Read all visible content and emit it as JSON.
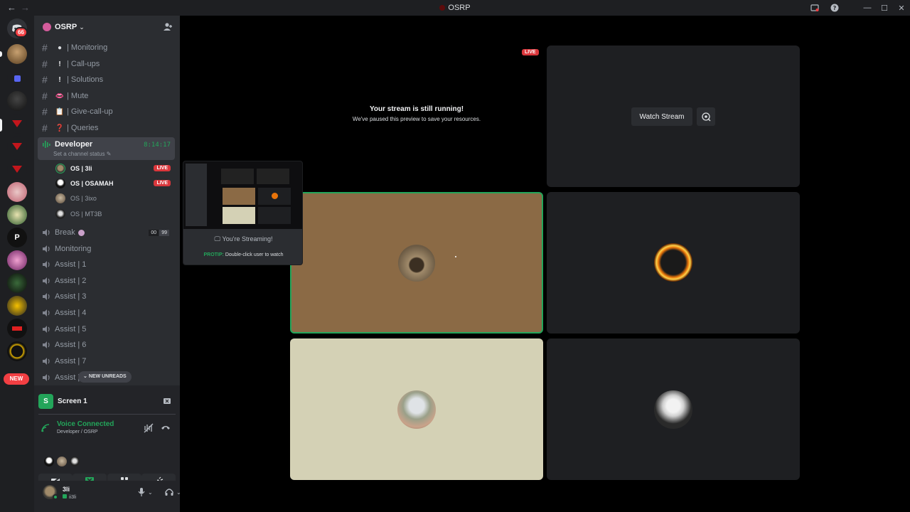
{
  "window": {
    "title": "OSRP"
  },
  "server": {
    "name": "OSRP"
  },
  "badges": {
    "dm_unread": "66",
    "new": "NEW"
  },
  "text_channels": [
    {
      "emoji": "●",
      "name": "| Monitoring"
    },
    {
      "emoji": "!",
      "name": "| Call-ups"
    },
    {
      "emoji": "!",
      "name": "| Solutions"
    },
    {
      "emoji": "👄",
      "name": "| Mute"
    },
    {
      "emoji": "📋",
      "name": "| Give-call-up"
    },
    {
      "emoji": "❓",
      "name": "| Queries"
    }
  ],
  "active_voice": {
    "name": "Developer",
    "status": "Set a channel status",
    "timer": "8:14:17",
    "users": [
      {
        "name": "OS | 3li",
        "live": "LIVE",
        "bold": true
      },
      {
        "name": "OS | OSAMAH",
        "live": "LIVE",
        "bold": true
      },
      {
        "name": "OS | 3ixo",
        "live": "",
        "bold": false
      },
      {
        "name": "OS | MT3B",
        "live": "",
        "bold": false
      }
    ]
  },
  "break_channel": {
    "name": "Break",
    "count_a": "00",
    "count_b": "99"
  },
  "voice_channels": [
    "Monitoring",
    "Assist | 1",
    "Assist | 2",
    "Assist | 3",
    "Assist | 4",
    "Assist | 5",
    "Assist | 6",
    "Assist | 7",
    "Assist |"
  ],
  "new_unreads": "NEW UNREADS",
  "screen_panel": {
    "label": "Screen 1",
    "icon_letter": "S"
  },
  "voice_status": {
    "title": "Voice Connected",
    "subtitle": "Developer / OSRP"
  },
  "user": {
    "name": "3li",
    "tag": "ii3li"
  },
  "stage": {
    "live": "LIVE",
    "paused_title": "Your stream is still running!",
    "paused_sub": "We've paused this preview to save your resources.",
    "watch_label": "Watch Stream"
  },
  "preview": {
    "streaming": "You're Streaming!",
    "protip_label": "PROTIP:",
    "protip_text": "Double-click user to watch"
  },
  "colors": {
    "green": "#23a55a",
    "red": "#da373c",
    "tile_brown": "#8b6a45",
    "tile_beige": "#d4d1b5"
  }
}
